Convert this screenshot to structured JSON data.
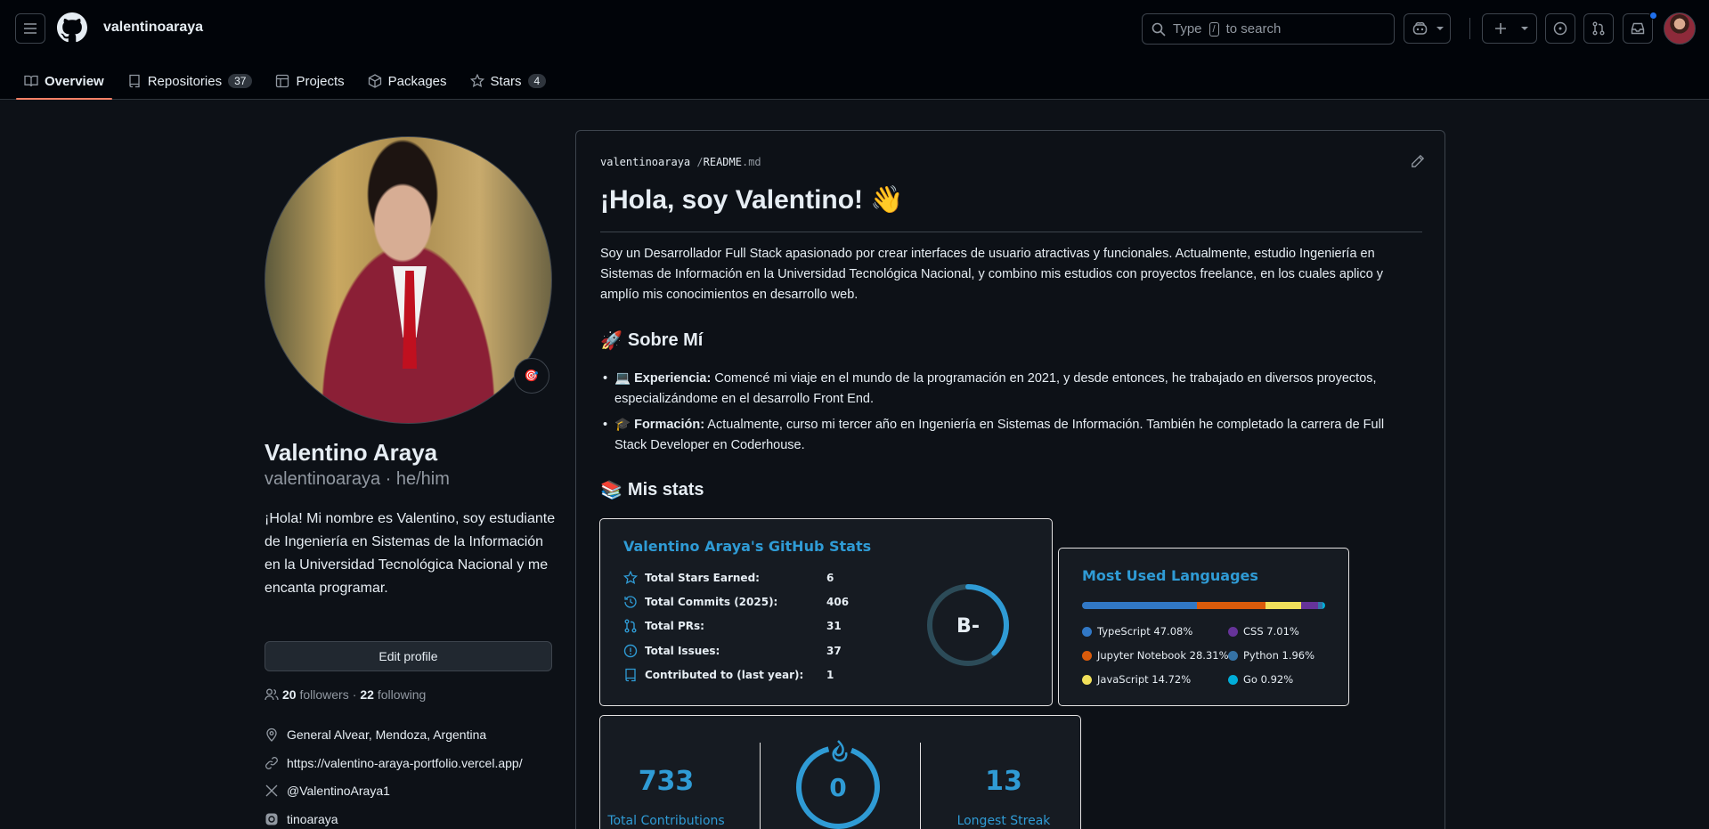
{
  "header": {
    "username": "valentinoaraya",
    "search_prefix": "Type",
    "search_key": "/",
    "search_suffix": "to search"
  },
  "tabs": [
    {
      "label": "Overview"
    },
    {
      "label": "Repositories",
      "count": "37"
    },
    {
      "label": "Projects"
    },
    {
      "label": "Packages"
    },
    {
      "label": "Stars",
      "count": "4"
    }
  ],
  "profile": {
    "status_emoji": "🎯",
    "name": "Valentino Araya",
    "login_pronouns": "valentinoaraya · he/him",
    "bio": "¡Hola! Mi nombre es Valentino, soy estudiante de Ingeniería en Sistemas de la Información en la Universidad Tecnológica Nacional y me encanta programar.",
    "edit_label": "Edit profile",
    "followers_count": "20",
    "followers_label": "followers",
    "sep": "·",
    "following_count": "22",
    "following_label": "following",
    "location": "General Alvear, Mendoza, Argentina",
    "website": "https://valentino-araya-portfolio.vercel.app/",
    "twitter": "@ValentinoAraya1",
    "instagram": "tinoaraya"
  },
  "readme": {
    "crumb_user": "valentinoaraya",
    "crumb_sep": "/",
    "crumb_file": "README",
    "crumb_ext": ".md",
    "title": "¡Hola, soy Valentino! 👋",
    "intro": "Soy un Desarrollador Full Stack apasionado por crear interfaces de usuario atractivas y funcionales. Actualmente, estudio Ingeniería en Sistemas de Información en la Universidad Tecnológica Nacional, y combino mis estudios con proyectos freelance, en los cuales aplico y amplío mis conocimientos en desarrollo web.",
    "about_emoji": "🚀",
    "about_title": "Sobre Mí",
    "exp_emoji": "💻",
    "exp_label": "Experiencia:",
    "exp_text": "Comencé mi viaje en el mundo de la programación en 2021, y desde entonces, he trabajado en diversos proyectos, especializándome en el desarrollo Front End.",
    "edu_emoji": "🎓",
    "edu_label": "Formación:",
    "edu_text": "Actualmente, curso mi tercer año en Ingeniería en Sistemas de Información. También he completado la carrera de Full Stack Developer en Coderhouse.",
    "stats_emoji": "📚",
    "stats_title": "Mis stats"
  },
  "github_stats": {
    "title": "Valentino Araya's GitHub Stats",
    "rows": [
      {
        "label": "Total Stars Earned:",
        "value": "6",
        "icon": "star-icon"
      },
      {
        "label": "Total Commits (2025):",
        "value": "406",
        "icon": "history-icon"
      },
      {
        "label": "Total PRs:",
        "value": "31",
        "icon": "pull-request-icon"
      },
      {
        "label": "Total Issues:",
        "value": "37",
        "icon": "issue-icon"
      },
      {
        "label": "Contributed to (last year):",
        "value": "1",
        "icon": "repo-icon"
      }
    ],
    "rank": "B-",
    "rank_progress": 0.38
  },
  "languages": {
    "title": "Most Used Languages",
    "items": [
      {
        "name": "TypeScript 47.08%",
        "pct": 47.08,
        "color": "#3178c6"
      },
      {
        "name": "Jupyter Notebook 28.31%",
        "pct": 28.31,
        "color": "#da5b0b"
      },
      {
        "name": "JavaScript 14.72%",
        "pct": 14.72,
        "color": "#f1e05a"
      },
      {
        "name": "CSS 7.01%",
        "pct": 7.01,
        "color": "#663399"
      },
      {
        "name": "Python 1.96%",
        "pct": 1.96,
        "color": "#3572a5"
      },
      {
        "name": "Go 0.92%",
        "pct": 0.92,
        "color": "#00add8"
      }
    ]
  },
  "streak": {
    "total_value": "733",
    "total_label": "Total Contributions",
    "current_value": "0",
    "longest_value": "13",
    "longest_label": "Longest Streak"
  },
  "colors": {
    "accent_underline": "#f78166",
    "card_title": "#2f9bd5",
    "notification": "#1f6feb"
  }
}
